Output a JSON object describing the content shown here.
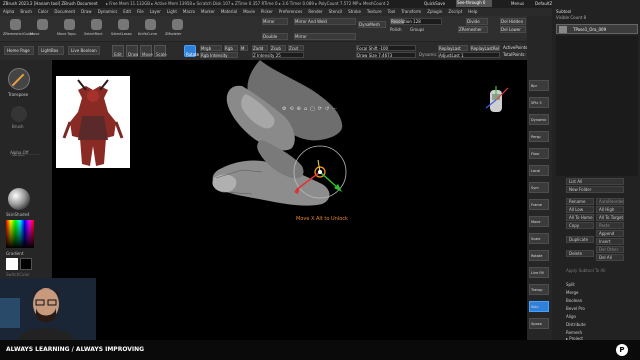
{
  "window": {
    "title": "ZBrush 2023.2 [Hanam tool]  ZBrush Document",
    "status": "▸ Free Mem 11.132GB ▸ Active Mem 13958 ▸ Scratch Disk 107 ▸ ZTime 0.357 RTime 0 ▸ 3.6 Timer 0.089 ▸ PolyCount 7.572 MP ▸ MeshCount 2",
    "quicksave": "QuickSave",
    "seethrough": "See-through 0",
    "menus_label": "Menus",
    "script": "DefaultZScript"
  },
  "menubar": {
    "items": [
      "Alpha",
      "Brush",
      "Color",
      "Document",
      "Draw",
      "Dynamics",
      "Edit",
      "File",
      "Layer",
      "Light",
      "Macro",
      "Marker",
      "Material",
      "Movie",
      "Picker",
      "Preferences",
      "Render",
      "Stencil",
      "Stroke",
      "Texture",
      "Tool",
      "Transform",
      "Zplugin",
      "Zscript",
      "Help"
    ]
  },
  "toolbar": {
    "tools": [
      "ZRemesherGuide",
      "Move",
      "Move Topo.",
      "SelectRect",
      "SelectLasso",
      "KnifeCurve",
      "ZModeler"
    ],
    "mirror": "Mirror",
    "mirror_weld": "Mirror And Weld",
    "dynamesh": "DynaMesh",
    "resolution": "Resolution 128",
    "resolution_value": 0.25,
    "polish": "Polish",
    "groups": "Groups",
    "double": "Double",
    "mirror2": "Mirror",
    "zremesher": "ZRemesher",
    "divide": "Divide",
    "del_hidden": "Del Hidden",
    "del_lower": "Del Lower"
  },
  "toolbar2": {
    "home_page": "Home Page",
    "lightbox": "LightBox",
    "live_boolean": "Live Boolean",
    "edit": "Edit",
    "draw": "Draw",
    "move": "Move",
    "scale": "Scale",
    "rotate": "Rotate",
    "zadd": "Zadd",
    "zsub": "Zsub",
    "zcut": "Zcut",
    "mrgb": "Mrgb",
    "rgb": "Rgb",
    "m": "M",
    "rgb_intensity": "Rgb Intensity",
    "z_intensity": "Z Intensity 25",
    "focal_shift": "Focal Shift -100",
    "draw_size": "Draw Size 7.4673",
    "dynamic": "Dynamic",
    "replay_last": "ReplayLast",
    "replay_last_rel": "ReplayLastRel",
    "adjust_last": "AdjustLast 1",
    "active_points": "ActivePoints: 7.497 Mil",
    "total_points": "TotalPoints: 7.497 Mil"
  },
  "left_shelf": {
    "transpose": "Transpose",
    "label2": "Brush",
    "label3": "Stroke",
    "label4": "Alpha Off",
    "material": "SkinShade4",
    "gradient": "Gradient",
    "switch_color": "SwitchColor"
  },
  "coords": "-1.4721,1.1957,-0.24",
  "viewport": {
    "hint": "Move X  Alt to Unlock"
  },
  "right_shelf": {
    "items": [
      "Bpr",
      "SPix 3",
      "Dynamic",
      "Persp",
      "Floor",
      "Local",
      "Sym",
      "Frame",
      "Move",
      "Scale",
      "Rotate",
      "Line Fill",
      "Transp",
      "Solo",
      "Xpose"
    ]
  },
  "subtool": {
    "header": "Subtool",
    "visible_count": "Visible Count 8",
    "item": "TPose1_Ora_009",
    "list_all": "List All",
    "new_folder": "New Folder",
    "rename": "Rename",
    "auto_reorder": "AutoReorder",
    "all_low": "All Low",
    "all_high": "All High",
    "all_to_home": "All To Home",
    "all_to_target": "All To Target",
    "copy": "Copy",
    "paste": "Paste",
    "append": "Append",
    "duplicate": "Duplicate",
    "insert": "Insert",
    "delete": "Delete",
    "del_other": "Del Other",
    "del_all": "Del All",
    "apply_btn": "Apply Subtool To All",
    "split": "Split",
    "merge": "Merge",
    "boolean": "Boolean",
    "bevel_pro": "Bevel Pro",
    "align": "Align",
    "distribute": "Distribute",
    "remesh": "Remesh",
    "project": "▸ Project"
  },
  "bottom": {
    "slogan": "ALWAYS LEARNING  / ALWAYS IMPROVING",
    "brand": "Pearson"
  },
  "colors": {
    "accent": "#2f80d8",
    "transpose_orange": "#e8a040",
    "hint_orange": "#e8862a"
  }
}
